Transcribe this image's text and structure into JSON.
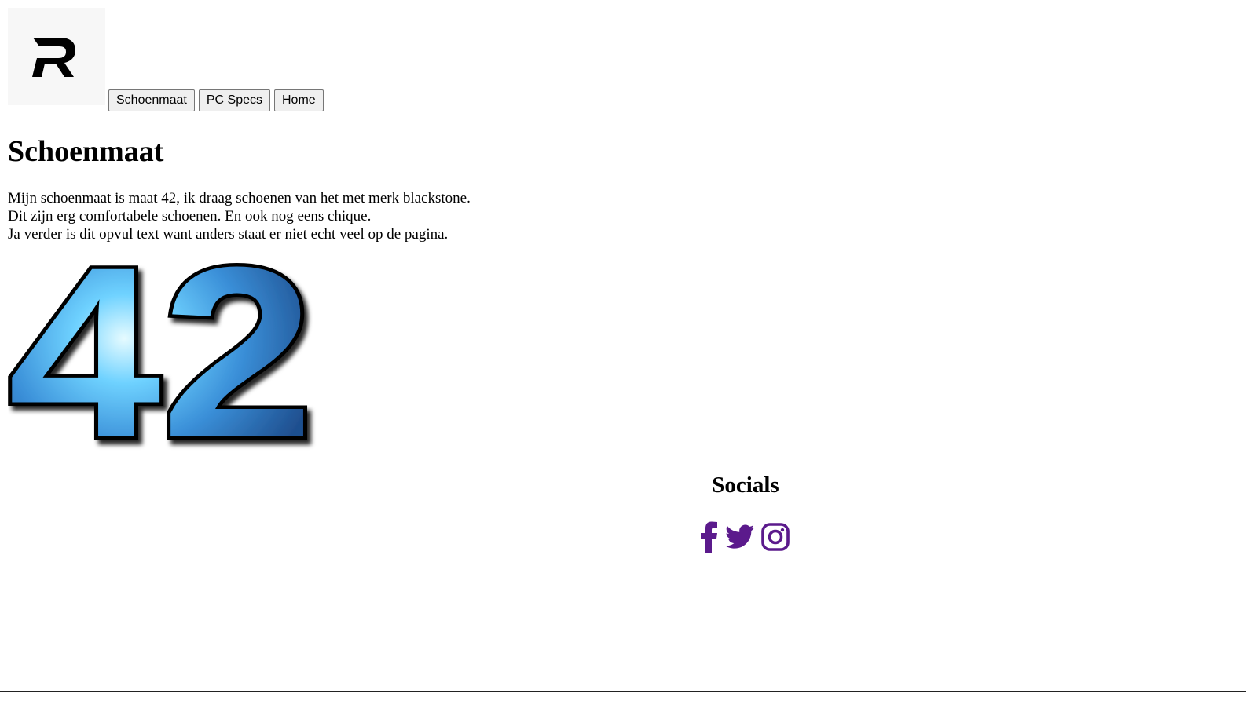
{
  "header": {
    "logo_icon": "r-logo-icon",
    "nav": [
      {
        "label": "Schoenmaat"
      },
      {
        "label": "PC Specs"
      },
      {
        "label": "Home"
      }
    ]
  },
  "main": {
    "title": "Schoenmaat",
    "paragraph_lines": [
      "Mijn schoenmaat is maat 42, ik draag schoenen van het met merk blackstone.",
      "Dit zijn erg comfortabele schoenen. En ook nog eens chique.",
      "Ja verder is dit opvul text want anders staat er niet echt veel op de pagina."
    ],
    "image_text": "42"
  },
  "socials": {
    "title": "Socials",
    "icons": [
      "facebook-icon",
      "twitter-icon",
      "instagram-icon"
    ],
    "icon_color": "#5b1a8c"
  },
  "colors": {
    "background": "#ffffff",
    "logo_bg": "#f7f7f7",
    "number_blue": "#3a8fd8"
  }
}
